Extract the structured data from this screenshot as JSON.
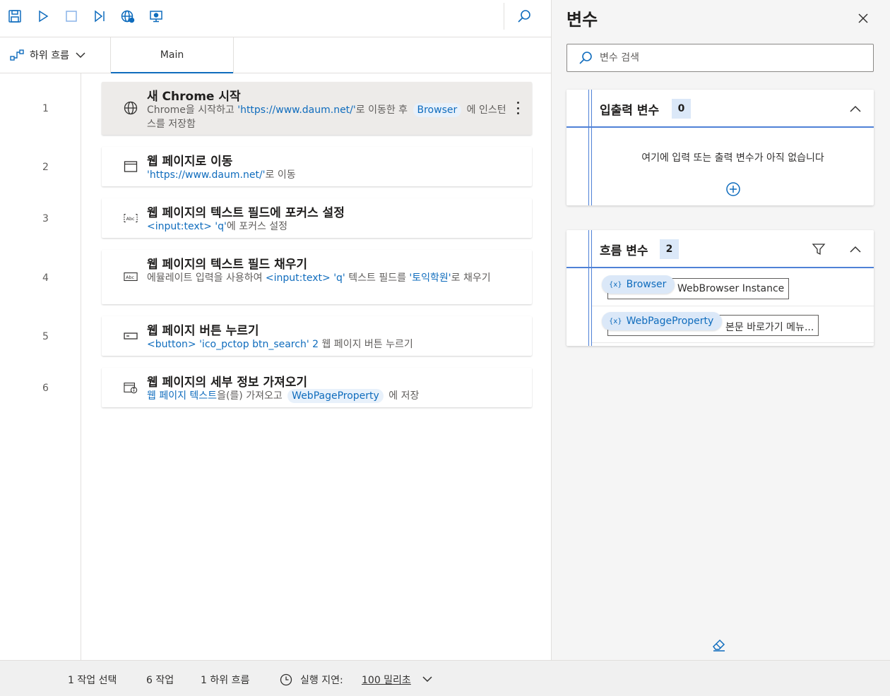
{
  "toolbar": {
    "icons": [
      "save-icon",
      "run-icon",
      "stop-icon",
      "next-step-icon",
      "web-recorder-icon",
      "desktop-recorder-icon",
      "search-icon"
    ]
  },
  "tabs": {
    "subflow_label": "하위 흐름",
    "main_label": "Main"
  },
  "actions": [
    {
      "line": "1",
      "title": "새 Chrome 시작",
      "icon": "globe-icon",
      "desc_pre": "Chrome을 시작하고 ",
      "desc_kw": "'https://www.daum.net/'",
      "desc_mid": "로 이동한 후 ",
      "desc_pill": "Browser",
      "desc_post": " 에 인스턴스를 저장함"
    },
    {
      "line": "2",
      "title": "웹 페이지로 이동",
      "icon": "browser-window-icon",
      "desc_kw": "'https://www.daum.net/'",
      "desc_post": "로 이동"
    },
    {
      "line": "3",
      "title": "웹 페이지의 텍스트 필드에 포커스 설정",
      "icon": "text-field-focus-icon",
      "desc_kw": "<input:text> 'q'",
      "desc_post": "에 포커스 설정"
    },
    {
      "line": "4",
      "title": "웹 페이지의 텍스트 필드 채우기",
      "icon": "text-field-icon",
      "desc_pre": "에뮬레이트 입력을 사용하여 ",
      "desc_kw": "<input:text> 'q'",
      "desc_mid": " 텍스트 필드를 ",
      "desc_kw2": "'토익학원'",
      "desc_post": "로 채우기"
    },
    {
      "line": "5",
      "title": "웹 페이지 버튼 누르기",
      "icon": "button-icon",
      "desc_kw": "<button> 'ico_pctop btn_search' 2",
      "desc_post": " 웹 페이지 버튼 누르기"
    },
    {
      "line": "6",
      "title": "웹 페이지의 세부 정보 가져오기",
      "icon": "page-details-icon",
      "desc_kw": "웹 페이지 텍스트",
      "desc_mid": "을(를) 가져오고 ",
      "desc_pill": "WebPageProperty",
      "desc_post": " 에 저장"
    }
  ],
  "variables": {
    "title": "변수",
    "search_placeholder": "변수 검색",
    "io_panel": {
      "title": "입출력 변수",
      "count": "0",
      "empty_message": "여기에 입력 또는 출력 변수가 아직 없습니다"
    },
    "flow_panel": {
      "title": "흐름 변수",
      "count": "2",
      "items": [
        {
          "name": "Browser",
          "value": "WebBrowser Instance"
        },
        {
          "name": "WebPageProperty",
          "value": "본문 바로가기  메뉴..."
        }
      ]
    }
  },
  "status": {
    "selected": "1 작업 선택",
    "actions": "6 작업",
    "subflows": "1 하위 흐름",
    "delay_label": "실행 지연:",
    "delay_value": "100 밀리초"
  },
  "colors": {
    "accent": "#0f6cbd",
    "panel_rule": "#4f81d6",
    "chip_bg": "#dbe8f8"
  }
}
